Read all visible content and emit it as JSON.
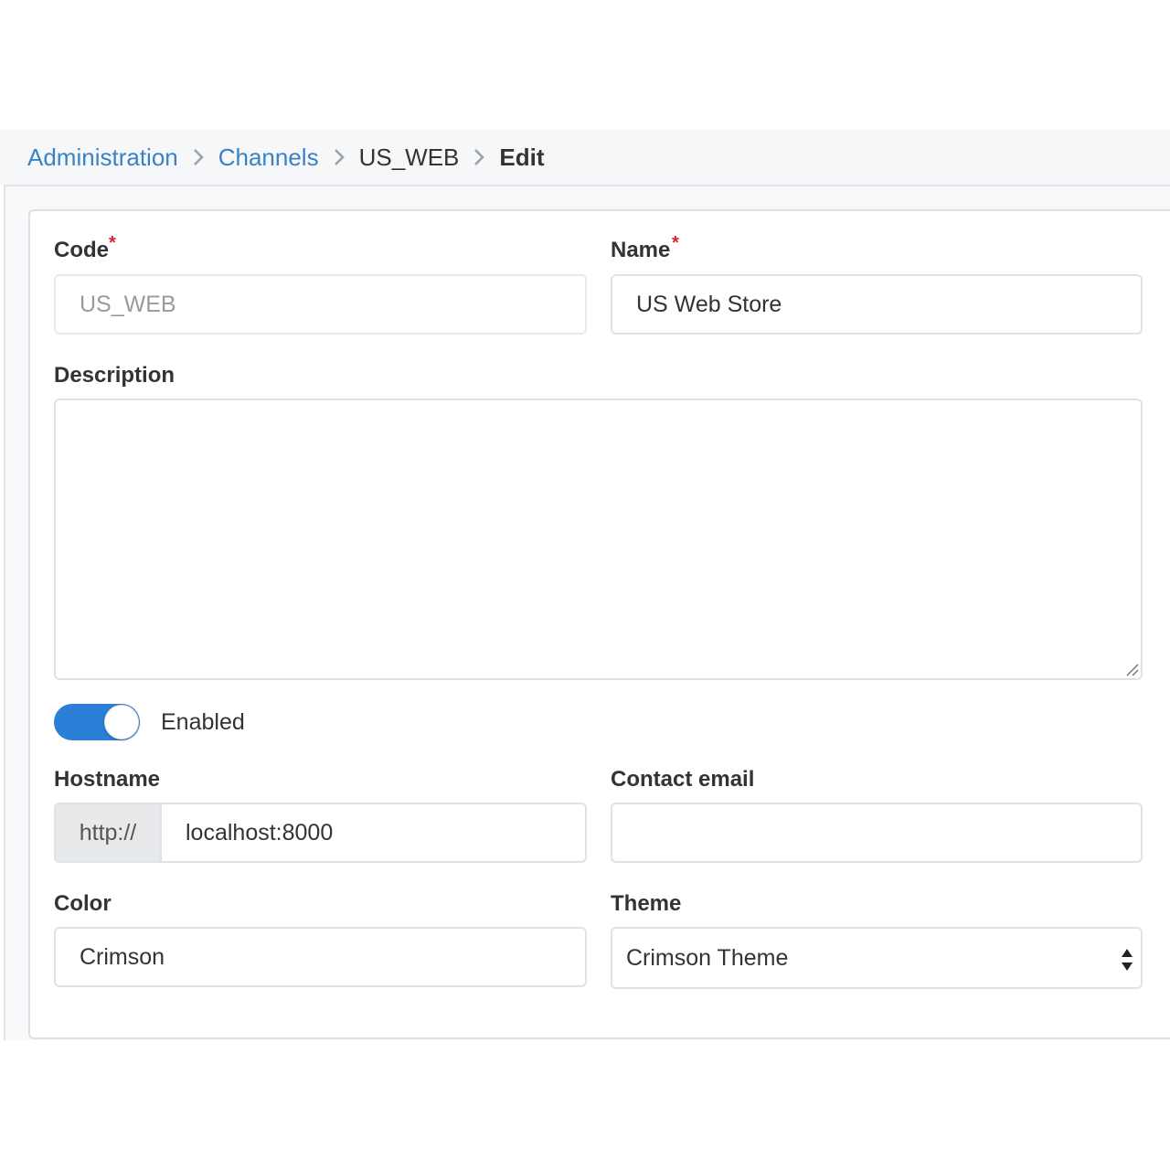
{
  "breadcrumb": {
    "items": [
      {
        "label": "Administration"
      },
      {
        "label": "Channels"
      },
      {
        "label": "US_WEB"
      },
      {
        "label": "Edit"
      }
    ]
  },
  "form": {
    "code": {
      "label": "Code",
      "value": "US_WEB",
      "required": true
    },
    "name": {
      "label": "Name",
      "value": "US Web Store",
      "required": true
    },
    "description": {
      "label": "Description",
      "value": ""
    },
    "enabled": {
      "label": "Enabled",
      "on": true
    },
    "hostname": {
      "label": "Hostname",
      "prefix": "http://",
      "value": "localhost:8000"
    },
    "contact_email": {
      "label": "Contact email",
      "value": ""
    },
    "color": {
      "label": "Color",
      "value": "Crimson"
    },
    "theme": {
      "label": "Theme",
      "selected": "Crimson Theme"
    }
  },
  "colors": {
    "link": "#3a82c5",
    "toggle_on": "#2b7fd6",
    "required_star": "#e0202b"
  },
  "icons": {
    "breadcrumb_separator": "chevron-right-icon",
    "select_arrows": "updown-arrows-icon",
    "textarea_grip": "resize-grip-icon"
  }
}
